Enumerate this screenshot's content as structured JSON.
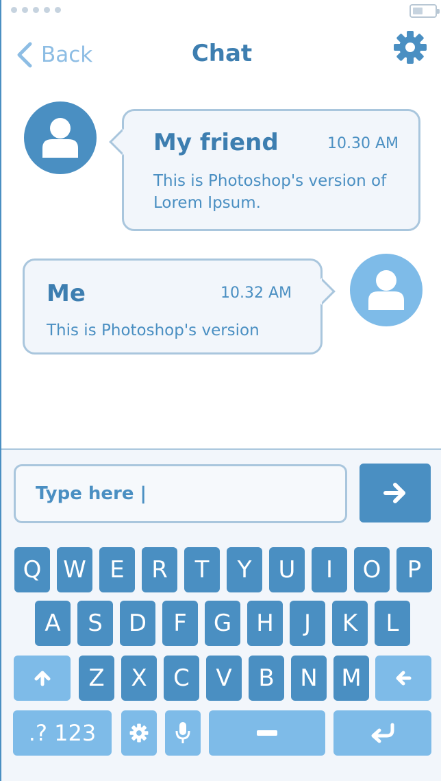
{
  "header": {
    "back_label": "Back",
    "title": "Chat"
  },
  "messages": [
    {
      "sender": "My friend",
      "time": "10.30 AM",
      "text": "This is Photoshop's version of Lorem Ipsum."
    },
    {
      "sender": "Me",
      "time": "10.32 AM",
      "text": "This is Photoshop's version"
    }
  ],
  "composer": {
    "value": "Type here |"
  },
  "keyboard": {
    "row1": [
      "Q",
      "W",
      "E",
      "R",
      "T",
      "Y",
      "U",
      "I",
      "O",
      "P"
    ],
    "row2": [
      "A",
      "S",
      "D",
      "F",
      "G",
      "H",
      "J",
      "K",
      "L"
    ],
    "row3": [
      "Z",
      "X",
      "C",
      "V",
      "B",
      "N",
      "M"
    ],
    "numbers_label": ".? 123"
  },
  "icons": {
    "status": "signal-dots-icon",
    "battery": "battery-icon",
    "back": "chevron-left-icon",
    "settings": "gear-icon",
    "avatar": "user-icon",
    "send": "arrow-right-icon",
    "shift": "arrow-up-icon",
    "backspace": "arrow-left-icon",
    "keyboard_settings": "gear-icon",
    "mic": "microphone-icon",
    "space": "space-bar-icon",
    "return": "return-icon"
  },
  "colors": {
    "primary": "#4a8fc2",
    "light": "#7ebbe8",
    "bubble_bg": "#f2f6fb",
    "bubble_border": "#a9c6dd"
  }
}
